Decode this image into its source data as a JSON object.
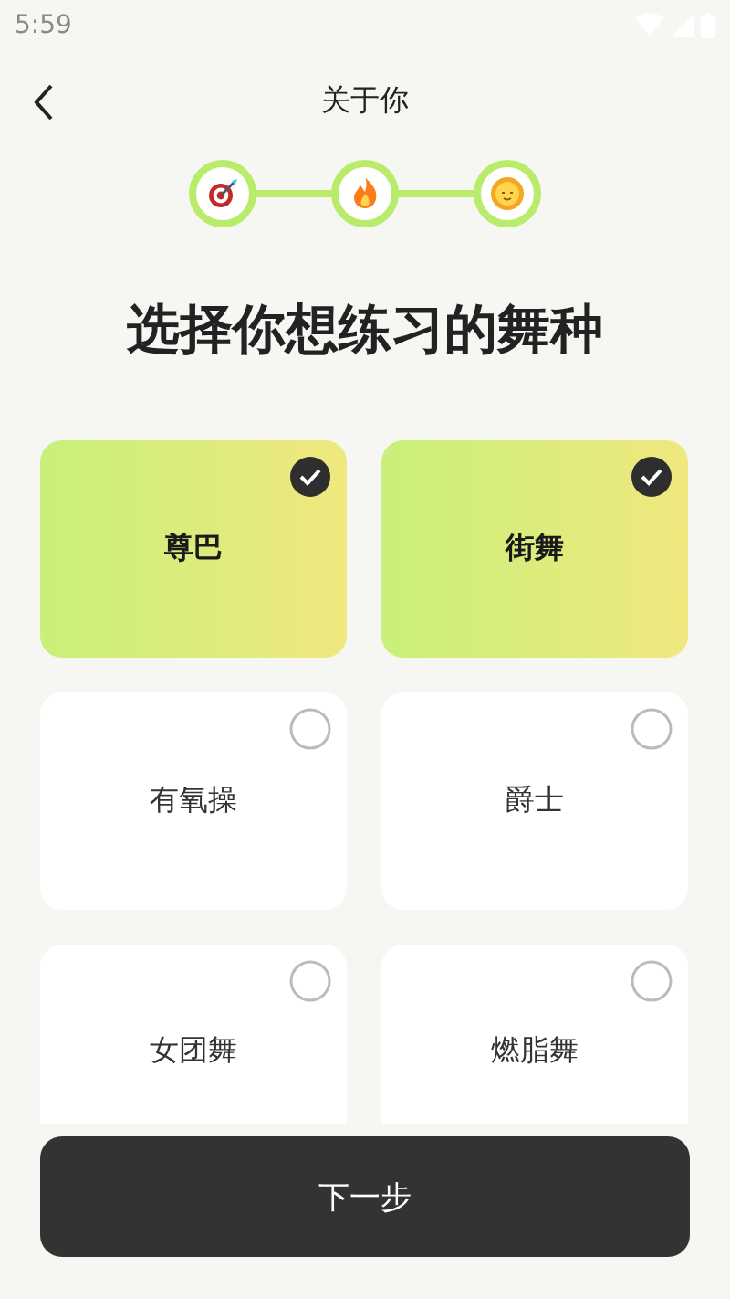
{
  "status_bar": {
    "time": "5:59"
  },
  "header": {
    "title": "关于你"
  },
  "steps": [
    {
      "kind": "target",
      "done": true
    },
    {
      "kind": "fire",
      "done": true
    },
    {
      "kind": "sun",
      "done": true
    }
  ],
  "heading": "选择你想练习的舞种",
  "options": [
    {
      "label": "尊巴",
      "selected": true
    },
    {
      "label": "街舞",
      "selected": true
    },
    {
      "label": "有氧操",
      "selected": false
    },
    {
      "label": "爵士",
      "selected": false
    },
    {
      "label": "女团舞",
      "selected": false
    },
    {
      "label": "燃脂舞",
      "selected": false
    }
  ],
  "next_button": "下一步"
}
